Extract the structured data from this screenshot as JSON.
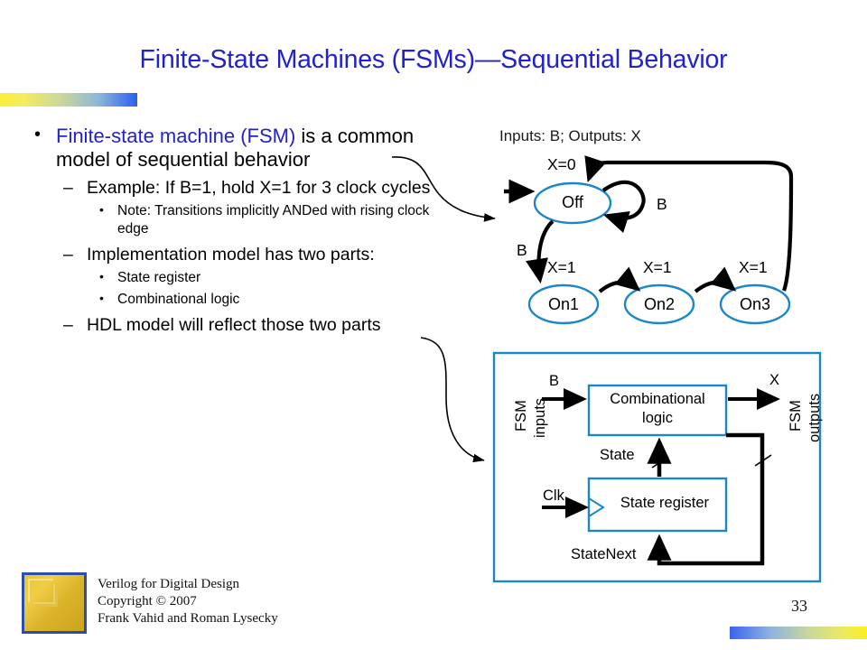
{
  "slide": {
    "title": "Finite-State Machines (FSMs)—Sequential Behavior",
    "page_number": "33",
    "accent_blue": "#2222CC",
    "diagram_blue": "#1B87C9",
    "bar_top_gradient": [
      "#FCEF3B",
      "#2C5EF0"
    ],
    "bar_bottom_gradient": [
      "#3B63F0",
      "#FAF022"
    ]
  },
  "bullets": {
    "level1": {
      "marker": "•",
      "highlight": "Finite-state machine (FSM)",
      "rest": " is a common model of sequential behavior"
    },
    "items": [
      {
        "level": 2,
        "marker": "–",
        "text": "Example: If B=1, hold X=1 for 3 clock cycles"
      },
      {
        "level": 3,
        "marker": "•",
        "text": "Note: Transitions implicitly ANDed with rising clock edge"
      },
      {
        "level": 2,
        "marker": "–",
        "text": "Implementation model has two parts:"
      },
      {
        "level": 3,
        "marker": "•",
        "text": "State register"
      },
      {
        "level": 3,
        "marker": "•",
        "text": "Combinational logic"
      },
      {
        "level": 2,
        "marker": "–",
        "text": "HDL model will reflect those two parts"
      }
    ]
  },
  "fsm_diagram": {
    "io_line": "Inputs: B; Outputs: X",
    "states": [
      {
        "name": "Off",
        "output_label": "X=0"
      },
      {
        "name": "On1",
        "output_label": "X=1"
      },
      {
        "name": "On2",
        "output_label": "X=1"
      },
      {
        "name": "On3",
        "output_label": "X=1"
      }
    ],
    "transition_labels": {
      "self_loop_off": "B",
      "off_to_on1": "B"
    }
  },
  "block_diagram": {
    "input_group_label_line1": "FSM",
    "input_group_label_line2": "inputs",
    "output_group_label_line1": "FSM",
    "output_group_label_line2": "outputs",
    "input_signal": "B",
    "output_signal": "X",
    "clock_signal": "Clk",
    "comb_block_line1": "Combinational",
    "comb_block_line2": "logic",
    "reg_block": "State register",
    "state_wire": "State",
    "statenext_wire": "StateNext"
  },
  "footer": {
    "line1": "Verilog for Digital Design",
    "line2": "Copyright © 2007",
    "line3": "Frank Vahid and Roman Lysecky"
  }
}
